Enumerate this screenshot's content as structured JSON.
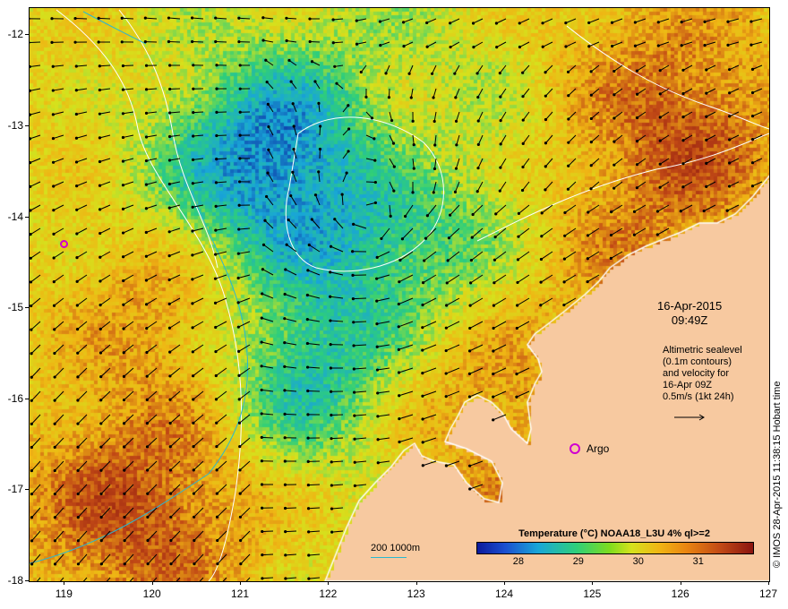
{
  "map": {
    "lon_range": [
      118.6,
      127
    ],
    "lat_range": [
      -18,
      -11.7
    ],
    "lon_ticks": [
      "119",
      "120",
      "121",
      "122",
      "123",
      "124",
      "125",
      "126",
      "127"
    ],
    "lat_ticks": [
      "-12",
      "-13",
      "-14",
      "-15",
      "-16",
      "-17",
      "-18"
    ],
    "land_color": "#f7c9a0",
    "ocean_palette": [
      "#0b1a9c",
      "#19a6d8",
      "#2fcf7a",
      "#d6e21d",
      "#f0b514",
      "#c24a16",
      "#8a1410"
    ]
  },
  "annotation": {
    "date": "16-Apr-2015",
    "time": "09:49Z",
    "info_lines": [
      "Altimetric sealevel",
      "(0.1m contours)",
      "and velocity for",
      "16-Apr 09Z",
      "0.5m/s (1kt 24h)"
    ]
  },
  "argo": {
    "label": "Argo",
    "lon": 124.8,
    "lat": -16.55,
    "color": "#d000d0"
  },
  "float2": {
    "lon": 119.0,
    "lat": -14.3
  },
  "legend": {
    "title": "Temperature (°C) NOAA18_L3U 4% ql>=2",
    "range": [
      27.3,
      31.9
    ],
    "ticks": [
      "28",
      "29",
      "30",
      "31"
    ]
  },
  "contour_key": {
    "label": "200  1000m",
    "color": "#2ab8d0"
  },
  "credit": "© IMOS 28-Apr-2015 11:38:15 Hobart time"
}
